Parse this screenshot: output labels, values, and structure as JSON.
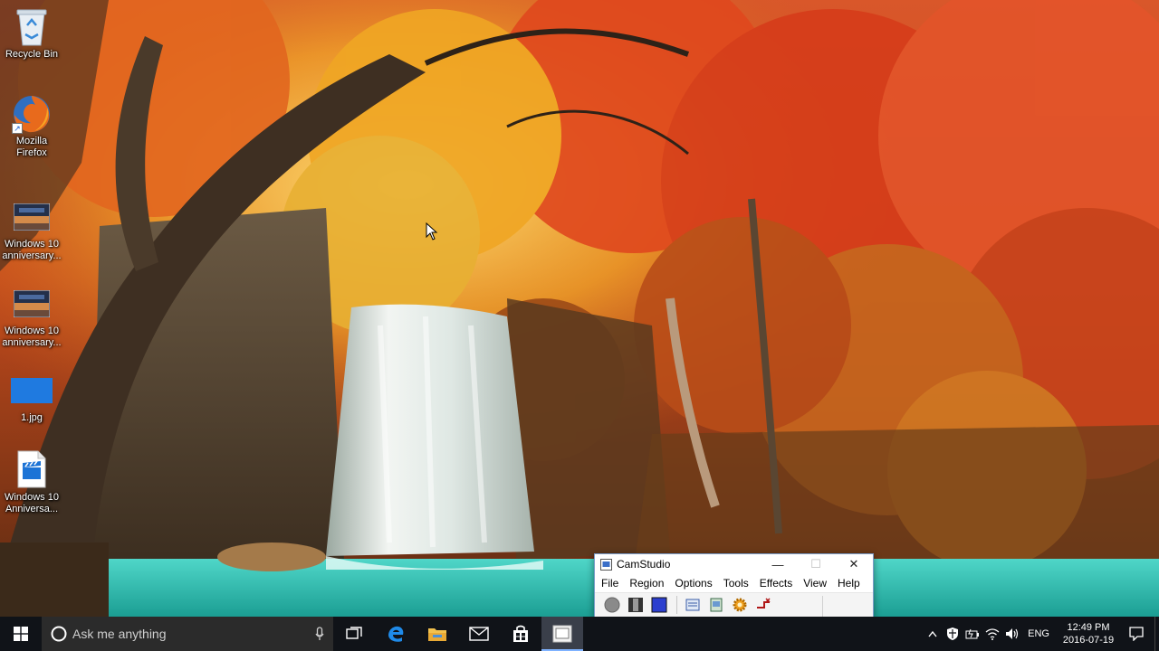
{
  "desktop": {
    "icons": [
      {
        "label": "Recycle Bin",
        "icon": "recycle-bin-icon"
      },
      {
        "label": "Mozilla\nFirefox",
        "icon": "firefox-icon"
      },
      {
        "label": "Windows 10\nanniversary...",
        "icon": "image-thumbnail-icon"
      },
      {
        "label": "Windows 10\nanniversary...",
        "icon": "image-thumbnail-icon"
      },
      {
        "label": "1.jpg",
        "icon": "jpg-image-icon"
      },
      {
        "label": "Windows 10\nAnniversa...",
        "icon": "video-file-icon"
      }
    ]
  },
  "camstudio": {
    "title": "CamStudio",
    "menu": [
      "File",
      "Region",
      "Options",
      "Tools",
      "Effects",
      "View",
      "Help"
    ],
    "toolbar": [
      "record-icon",
      "pause-icon",
      "stop-icon",
      "region-icon",
      "annotation-icon",
      "settings-icon",
      "autopan-icon"
    ]
  },
  "taskbar": {
    "search_placeholder": "Ask me anything",
    "apps": [
      "task-view-icon",
      "edge-icon",
      "file-explorer-icon",
      "mail-icon",
      "store-icon",
      "camstudio-icon"
    ],
    "language": "ENG",
    "time": "12:49 PM",
    "date": "2016-07-19"
  },
  "colors": {
    "taskbar_bg": "#101318",
    "search_bg": "#2b2b2b",
    "accent": "#7fb2ff"
  }
}
